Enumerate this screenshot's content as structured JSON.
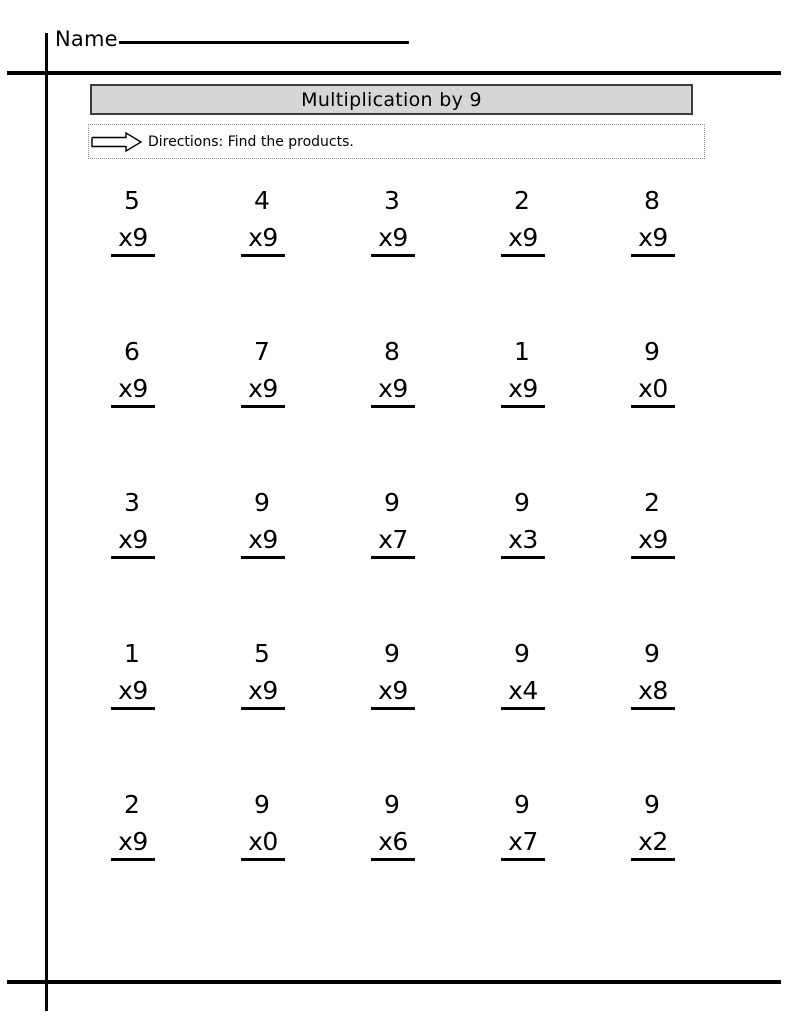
{
  "name_field": {
    "label": "Name",
    "blank_value": ""
  },
  "title": {
    "text": "Multiplication by 9"
  },
  "directions": {
    "icon": "right-arrow-icon",
    "text": "Directions: Find the products."
  },
  "colors": {
    "banner_fill": "#d6d6d6",
    "banner_border": "#3c3c3c",
    "directions_border": "#8e8e8e",
    "rule": "#000000"
  },
  "worksheet": {
    "operator": "x",
    "rows": [
      {
        "cells": [
          {
            "top": "5",
            "bottom": "x9"
          },
          {
            "top": "4",
            "bottom": "x9"
          },
          {
            "top": "3",
            "bottom": "x9"
          },
          {
            "top": "2",
            "bottom": "x9"
          },
          {
            "top": "8",
            "bottom": "x9"
          }
        ]
      },
      {
        "cells": [
          {
            "top": "6",
            "bottom": "x9"
          },
          {
            "top": "7",
            "bottom": "x9"
          },
          {
            "top": "8",
            "bottom": "x9"
          },
          {
            "top": "1",
            "bottom": "x9"
          },
          {
            "top": "9",
            "bottom": "x0"
          }
        ]
      },
      {
        "cells": [
          {
            "top": "3",
            "bottom": "x9"
          },
          {
            "top": "9",
            "bottom": "x9"
          },
          {
            "top": "9",
            "bottom": "x7"
          },
          {
            "top": "9",
            "bottom": "x3"
          },
          {
            "top": "2",
            "bottom": "x9"
          }
        ]
      },
      {
        "cells": [
          {
            "top": "1",
            "bottom": "x9"
          },
          {
            "top": "5",
            "bottom": "x9"
          },
          {
            "top": "9",
            "bottom": "x9"
          },
          {
            "top": "9",
            "bottom": "x4"
          },
          {
            "top": "9",
            "bottom": "x8"
          }
        ]
      },
      {
        "cells": [
          {
            "top": "2",
            "bottom": "x9"
          },
          {
            "top": "9",
            "bottom": "x0"
          },
          {
            "top": "9",
            "bottom": "x6"
          },
          {
            "top": "9",
            "bottom": "x7"
          },
          {
            "top": "9",
            "bottom": "x2"
          }
        ]
      }
    ]
  }
}
